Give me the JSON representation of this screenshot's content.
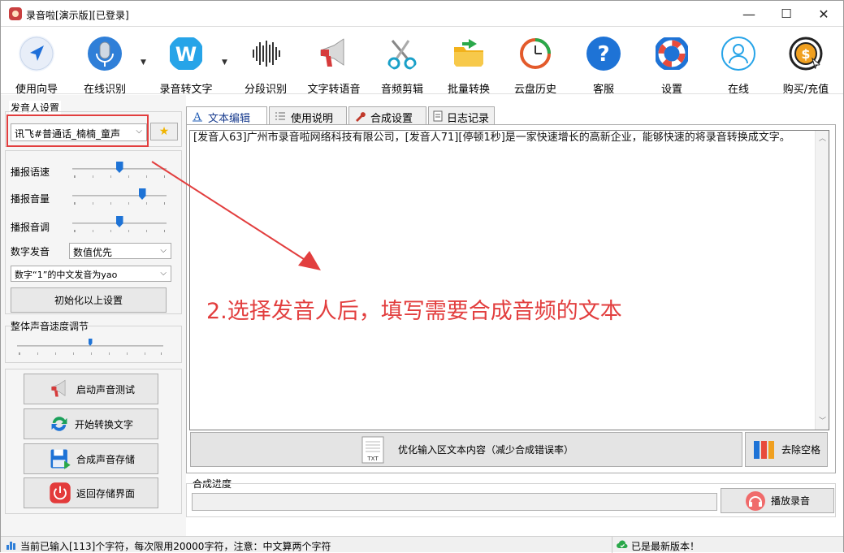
{
  "window": {
    "title": "录音啦[演示版][已登录]",
    "minimize": "—",
    "maximize": "☐",
    "close": "✕"
  },
  "toolbar": {
    "items": [
      {
        "label": "使用向导",
        "icon": "navigation-arrow-icon"
      },
      {
        "label": "在线识别",
        "icon": "microphone-icon"
      },
      {
        "label": "录音转文字",
        "icon": "w-logo-icon"
      },
      {
        "label": "分段识别",
        "icon": "waveform-icon"
      },
      {
        "label": "文字转语音",
        "icon": "megaphone-icon"
      },
      {
        "label": "音频剪辑",
        "icon": "scissors-icon"
      },
      {
        "label": "批量转换",
        "icon": "folder-icon"
      },
      {
        "label": "云盘历史",
        "icon": "history-clock-icon"
      },
      {
        "label": "客服",
        "icon": "question-icon"
      },
      {
        "label": "设置",
        "icon": "lifebuoy-icon"
      },
      {
        "label": "在线",
        "icon": "user-icon"
      },
      {
        "label": "购买/充值",
        "icon": "coin-icon"
      }
    ]
  },
  "left": {
    "voice_group_label": "发音人设置",
    "voice_select": "讯飞#普通话_楠楠_童声",
    "speed_label": "播报语速",
    "volume_label": "播报音量",
    "pitch_label": "播报音调",
    "speed_value": 0.5,
    "volume_value": 0.75,
    "pitch_value": 0.5,
    "digit_label": "数字发音",
    "digit_select": "数值优先",
    "one_select": "数字“1”的中文发音为yao",
    "reset_button": "初始化以上设置",
    "overall_speed_label": "整体声音速度调节",
    "overall_speed_value": 0.5,
    "actions": [
      {
        "label": "启动声音测试",
        "icon": "megaphone-icon"
      },
      {
        "label": "开始转换文字",
        "icon": "refresh-icon"
      },
      {
        "label": "合成声音存储",
        "icon": "save-icon"
      },
      {
        "label": "返回存储界面",
        "icon": "power-icon"
      }
    ]
  },
  "tabs": [
    {
      "label": "文本编辑"
    },
    {
      "label": "使用说明"
    },
    {
      "label": "合成设置"
    },
    {
      "label": "日志记录"
    }
  ],
  "editor": {
    "text": "[发音人63]广州市录音啦网络科技有限公司，[发音人71][停顿1秒]是一家快速增长的高新企业，能够快速的将录音转换成文字。"
  },
  "annotation": "2.选择发音人后，填写需要合成音频的文本",
  "optimize_button": "优化输入区文本内容（减少合成错误率）",
  "remove_space_button": "去除空格",
  "progress": {
    "label": "合成进度",
    "value": 0
  },
  "play_button": "播放录音",
  "status": {
    "left": "当前已输入[113]个字符，每次限用20000字符，注意：中文算两个字符",
    "right": "已是最新版本！"
  }
}
